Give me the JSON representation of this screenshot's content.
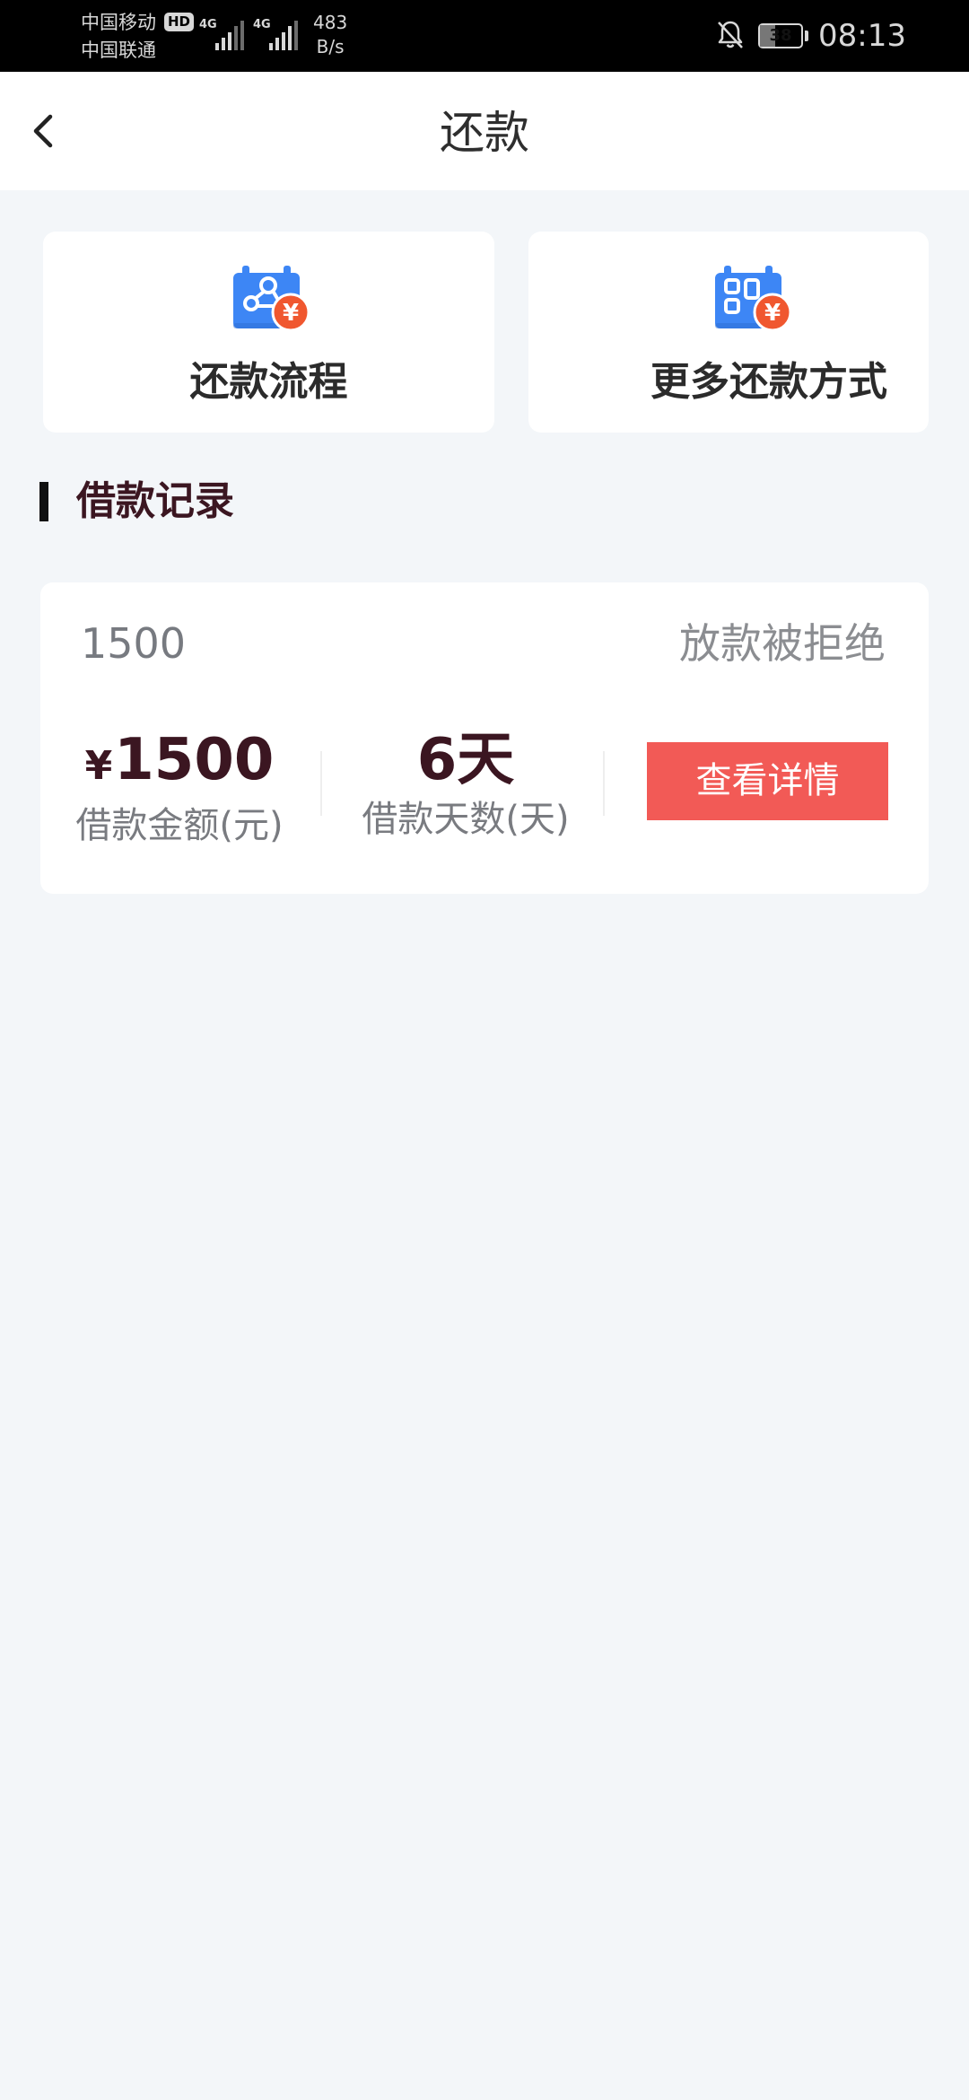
{
  "status_bar": {
    "carrier_1": "中国移动",
    "carrier_2": "中国联通",
    "hd_badge": "HD",
    "network_1": "4G",
    "network_2": "4G",
    "speed_value": "483",
    "speed_unit": "B/s",
    "battery_level": "38",
    "time": "08:13",
    "icons": [
      "signal-icon",
      "mute-bell-icon",
      "battery-icon"
    ]
  },
  "header": {
    "back_icon": "chevron-left-icon",
    "title": "还款"
  },
  "shortcuts": [
    {
      "label": "还款流程",
      "icon": "repayment-flow-icon"
    },
    {
      "label": "更多还款方式",
      "icon": "more-methods-icon"
    }
  ],
  "section": {
    "title": "借款记录"
  },
  "record": {
    "title": "1500",
    "status": "放款被拒绝",
    "amount_symbol": "¥",
    "amount_value": "1500",
    "amount_caption": "借款金额(元)",
    "days_value": "6天",
    "days_caption": "借款天数(天)",
    "detail_button": "查看详情"
  },
  "colors": {
    "accent_blue": "#3d86f5",
    "badge_orange": "#f0572f",
    "button_red": "#f25a56",
    "heading_dark": "#3b1621",
    "background": "#f3f6f9"
  }
}
